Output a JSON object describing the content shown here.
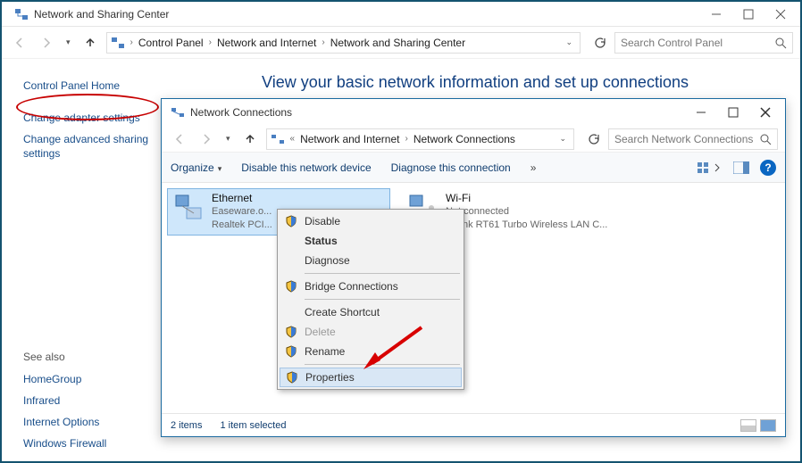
{
  "outer": {
    "title": "Network and Sharing Center",
    "breadcrumb": {
      "a": "Control Panel",
      "b": "Network and Internet",
      "c": "Network and Sharing Center"
    },
    "search_placeholder": "Search Control Panel",
    "heading": "View your basic network information and set up connections"
  },
  "sidebar": {
    "home": "Control Panel Home",
    "adapter": "Change adapter settings",
    "advanced": "Change advanced sharing settings",
    "seealso_title": "See also",
    "seealso": {
      "a": "HomeGroup",
      "b": "Infrared",
      "c": "Internet Options",
      "d": "Windows Firewall"
    }
  },
  "inner": {
    "title": "Network Connections",
    "breadcrumb": {
      "a": "Network and Internet",
      "b": "Network Connections"
    },
    "search_placeholder": "Search Network Connections",
    "tools": {
      "organize": "Organize",
      "disable": "Disable this network device",
      "diagnose": "Diagnose this connection"
    },
    "adapters": {
      "eth": {
        "name": "Ethernet",
        "line2": "Easeware.o...",
        "line3": "Realtek PCI..."
      },
      "wifi": {
        "name": "Wi-Fi",
        "line2": "Not connected",
        "line3": "Ralink RT61 Turbo Wireless LAN C..."
      }
    },
    "context": {
      "disable": "Disable",
      "status": "Status",
      "diagnose": "Diagnose",
      "bridge": "Bridge Connections",
      "shortcut": "Create Shortcut",
      "delete": "Delete",
      "rename": "Rename",
      "properties": "Properties"
    },
    "status": {
      "count": "2 items",
      "selected": "1 item selected"
    }
  }
}
